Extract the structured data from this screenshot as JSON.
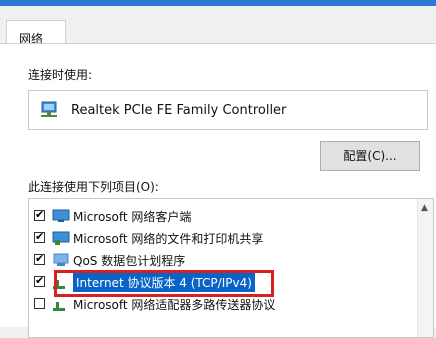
{
  "tabs": [
    {
      "label": "网络"
    }
  ],
  "connect_using_label": "连接时使用:",
  "adapter": {
    "name": "Realtek PCIe FE Family Controller",
    "icon": "network-adapter-icon"
  },
  "configure_button": "配置(C)...",
  "items_label": "此连接使用下列项目(O):",
  "items": [
    {
      "label": "Microsoft 网络客户端",
      "checked": true,
      "icon": "network-client-icon"
    },
    {
      "label": "Microsoft 网络的文件和打印机共享",
      "checked": true,
      "icon": "file-printer-share-icon"
    },
    {
      "label": "QoS 数据包计划程序",
      "checked": true,
      "icon": "qos-icon"
    },
    {
      "label": "Internet 协议版本 4 (TCP/IPv4)",
      "checked": true,
      "selected": true,
      "icon": "protocol-icon"
    },
    {
      "label": "Microsoft 网络适配器多路传送器协议",
      "checked": false,
      "icon": "protocol-icon"
    }
  ],
  "colors": {
    "selection": "#0a64c8",
    "highlight_frame": "#d62121",
    "titlebar": "#2b7bd4"
  }
}
